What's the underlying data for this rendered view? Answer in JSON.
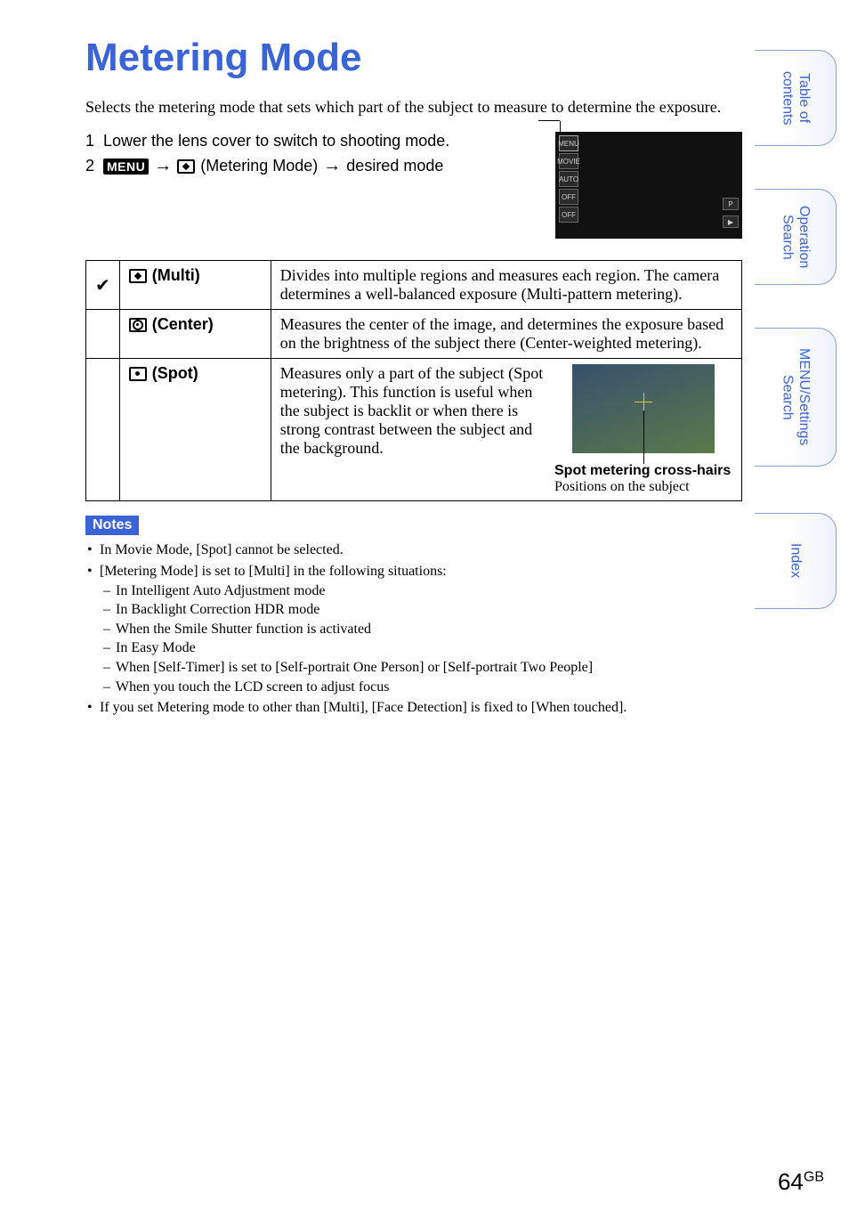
{
  "title": "Metering Mode",
  "intro": "Selects the metering mode that sets which part of the subject to measure to determine the exposure.",
  "steps": {
    "s1_num": "1",
    "s1_text": "Lower the lens cover to switch to shooting mode.",
    "s2_num": "2",
    "s2_menu": "MENU",
    "s2_arrow": "→",
    "s2_mid": "(Metering Mode)",
    "s2_arrow2": "→",
    "s2_tail": "desired mode"
  },
  "screenshot": {
    "menu": "MENU",
    "movie": "MOVIE",
    "flash": "AUTO",
    "timer": "OFF",
    "smile": "OFF",
    "mode_p": "P",
    "play": "▶"
  },
  "table": {
    "check": "✔",
    "multi": {
      "name": "(Multi)",
      "desc": "Divides into multiple regions and measures each region. The camera determines a well-balanced exposure (Multi-pattern metering)."
    },
    "center": {
      "name": "(Center)",
      "desc": "Measures the center of the image, and determines the exposure based on the brightness of the subject there (Center-weighted metering)."
    },
    "spot": {
      "name": "(Spot)",
      "desc": "Measures only a part of the subject (Spot metering). This function is useful when the subject is backlit or when there is strong contrast between the subject and the background.",
      "label": "Spot metering cross-hairs",
      "sub": "Positions on the subject"
    }
  },
  "notes": {
    "heading": "Notes",
    "n1": "In Movie Mode, [Spot] cannot be selected.",
    "n2": "[Metering Mode] is set to [Multi] in the following situations:",
    "n2a": "In Intelligent Auto Adjustment mode",
    "n2b": "In Backlight Correction HDR mode",
    "n2c": "When the Smile Shutter function is activated",
    "n2d": "In Easy Mode",
    "n2e": "When [Self-Timer] is set to [Self-portrait One Person] or [Self-portrait Two People]",
    "n2f": "When you touch the LCD screen to adjust focus",
    "n3": "If you set Metering mode to other than [Multi], [Face Detection] is fixed to [When touched]."
  },
  "tabs": {
    "t1": "Table of contents",
    "t2": "Operation Search",
    "t3": "MENU/Settings Search",
    "t4": "Index"
  },
  "page": {
    "num": "64",
    "suffix": "GB"
  }
}
